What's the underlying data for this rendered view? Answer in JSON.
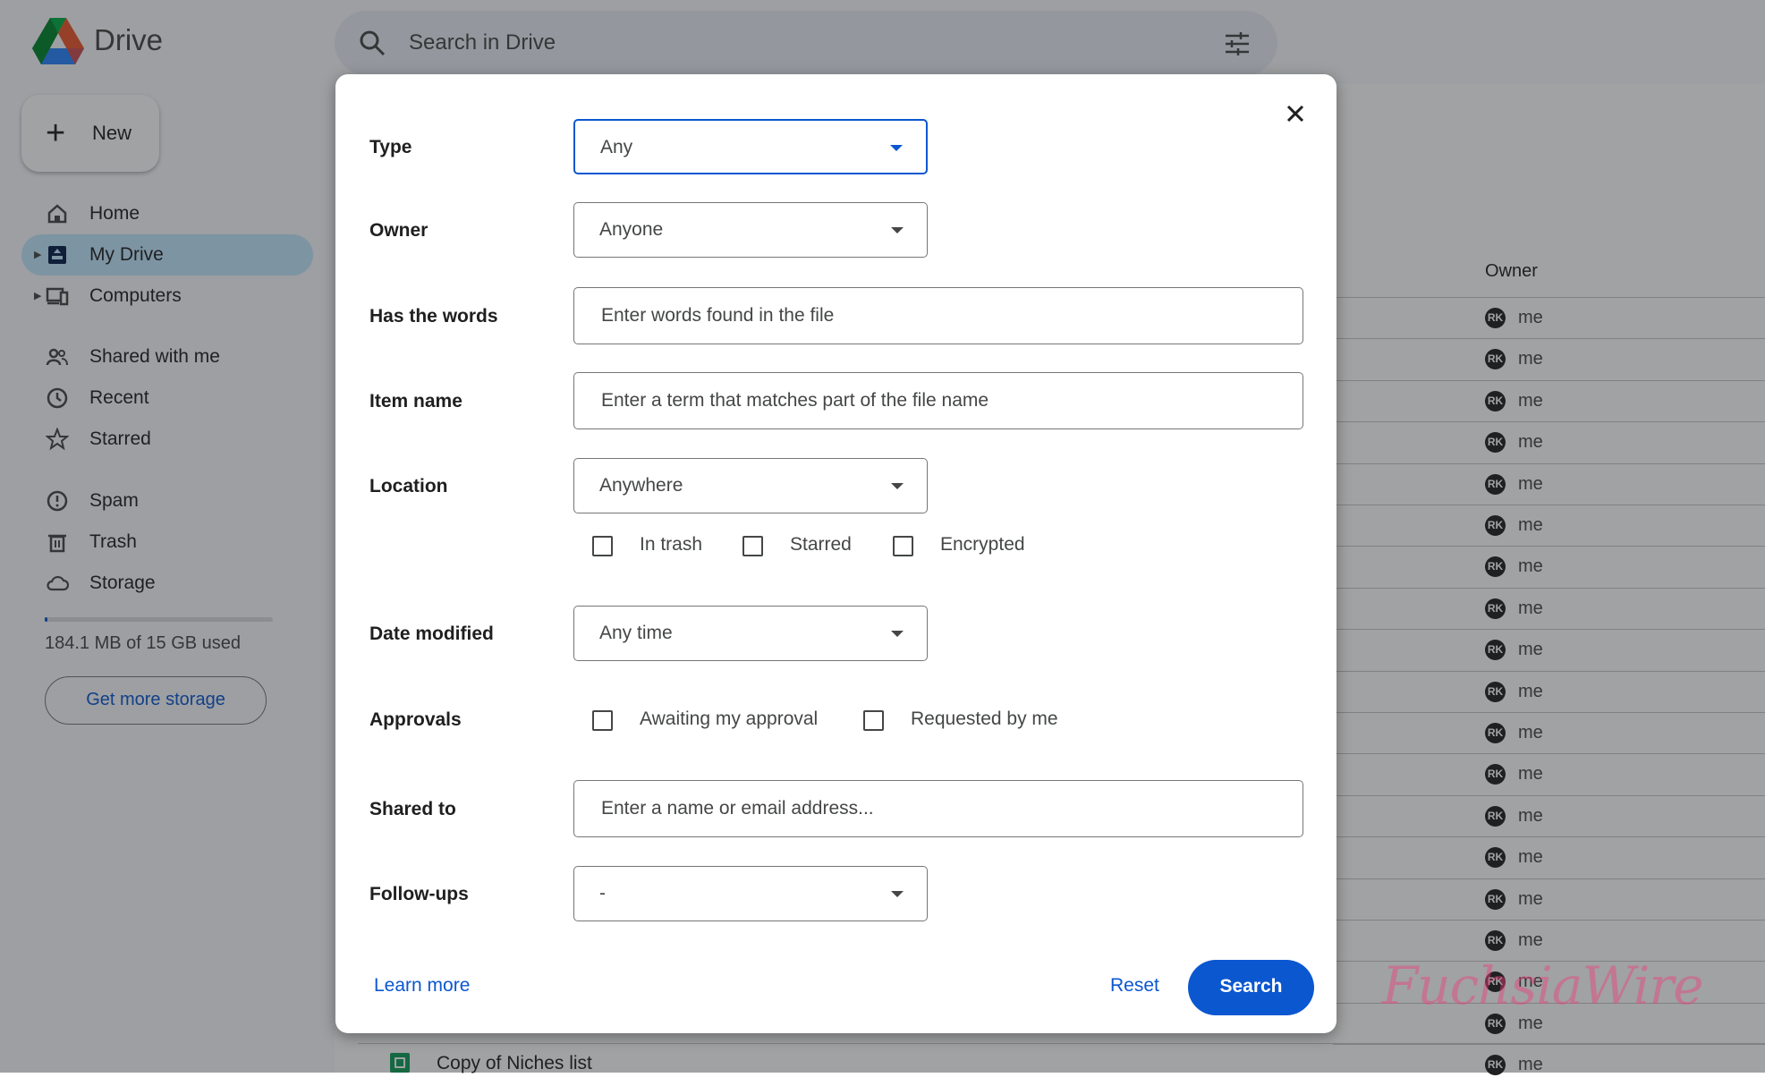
{
  "app": {
    "brand": "Drive"
  },
  "search": {
    "placeholder": "Search in Drive"
  },
  "sidebar": {
    "new_label": "New",
    "items": [
      {
        "label": "Home",
        "icon": "home-icon"
      },
      {
        "label": "My Drive",
        "icon": "drive-icon",
        "active": true
      },
      {
        "label": "Computers",
        "icon": "computers-icon"
      },
      {
        "label": "Shared with me",
        "icon": "shared-icon"
      },
      {
        "label": "Recent",
        "icon": "clock-icon"
      },
      {
        "label": "Starred",
        "icon": "star-icon"
      },
      {
        "label": "Spam",
        "icon": "spam-icon"
      },
      {
        "label": "Trash",
        "icon": "trash-icon"
      },
      {
        "label": "Storage",
        "icon": "cloud-icon"
      }
    ],
    "storage_used_fraction": 0.012,
    "storage_text": "184.1 MB of 15 GB used",
    "get_storage_label": "Get more storage"
  },
  "file_list": {
    "owner_header": "Owner",
    "owner_initials": "RK",
    "owner_value": "me",
    "visible_file": "Copy of Niches list"
  },
  "dialog": {
    "type": {
      "label": "Type",
      "value": "Any"
    },
    "owner": {
      "label": "Owner",
      "value": "Anyone"
    },
    "has_words": {
      "label": "Has the words",
      "placeholder": "Enter words found in the file"
    },
    "item_name": {
      "label": "Item name",
      "placeholder": "Enter a term that matches part of the file name"
    },
    "location": {
      "label": "Location",
      "value": "Anywhere",
      "checkboxes": [
        "In trash",
        "Starred",
        "Encrypted"
      ]
    },
    "date_modified": {
      "label": "Date modified",
      "value": "Any time"
    },
    "approvals": {
      "label": "Approvals",
      "checkboxes": [
        "Awaiting my approval",
        "Requested by me"
      ]
    },
    "shared_to": {
      "label": "Shared to",
      "placeholder": "Enter a name or email address..."
    },
    "follow_ups": {
      "label": "Follow-ups",
      "value": "-"
    },
    "learn_more": "Learn more",
    "reset": "Reset",
    "search": "Search"
  },
  "watermark": "FuchsiaWire",
  "colors": {
    "accent": "#0b57d0",
    "active_nav": "#c2e7ff",
    "sheets_green": "#0f9d58"
  }
}
